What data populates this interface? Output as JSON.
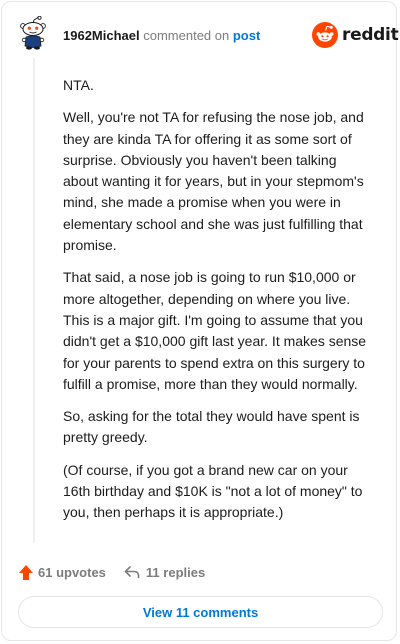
{
  "comment": {
    "author": "1962Michael",
    "action": "commented on",
    "post_link": "post",
    "brand": "reddit",
    "paragraphs": [
      "NTA.",
      "Well, you're not TA for refusing the nose job, and they are kinda TA for offering it as some sort of surprise. Obviously you haven't been talking about wanting it for years, but in your stepmom's mind, she made a promise when you were in elementary school and she was just fulfilling that promise.",
      "That said, a nose job is going to run $10,000 or more altogether, depending on where you live. This is a major gift. I'm going to assume that you didn't get a $10,000 gift last year. It makes sense for your parents to spend extra on this surgery to fulfill a promise, more than they would normally.",
      "So, asking for the total they would have spent is pretty greedy.",
      "(Of course, if you got a brand new car on your 16th birthday and $10K is \"not a lot of money\" to you, then perhaps it is appropriate.)"
    ],
    "upvotes": "61 upvotes",
    "replies": "11 replies",
    "view_comments": "View 11 comments"
  },
  "icons": {
    "avatar": "snoo-avatar-icon",
    "brand_logo": "reddit-logo-icon",
    "upvote": "upvote-arrow-icon",
    "reply": "reply-arrow-icon"
  },
  "colors": {
    "brand_orange": "#ff4500",
    "link_blue": "#0079d3",
    "muted_gray": "#7c7c7c"
  }
}
